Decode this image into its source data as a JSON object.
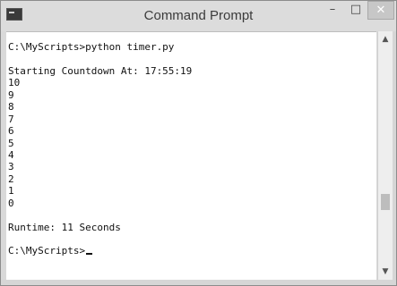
{
  "window": {
    "title": "Command Prompt",
    "controls": {
      "minimize": "–",
      "maximize": "□",
      "close": "✕"
    }
  },
  "console": {
    "lines": [
      "C:\\MyScripts>python timer.py",
      "",
      "Starting Countdown At: 17:55:19",
      "10",
      "9",
      "8",
      "7",
      "6",
      "5",
      "4",
      "3",
      "2",
      "1",
      "0",
      "",
      "Runtime: 11 Seconds",
      "",
      "C:\\MyScripts>"
    ]
  },
  "scrollbar": {
    "up": "▲",
    "down": "▼"
  }
}
